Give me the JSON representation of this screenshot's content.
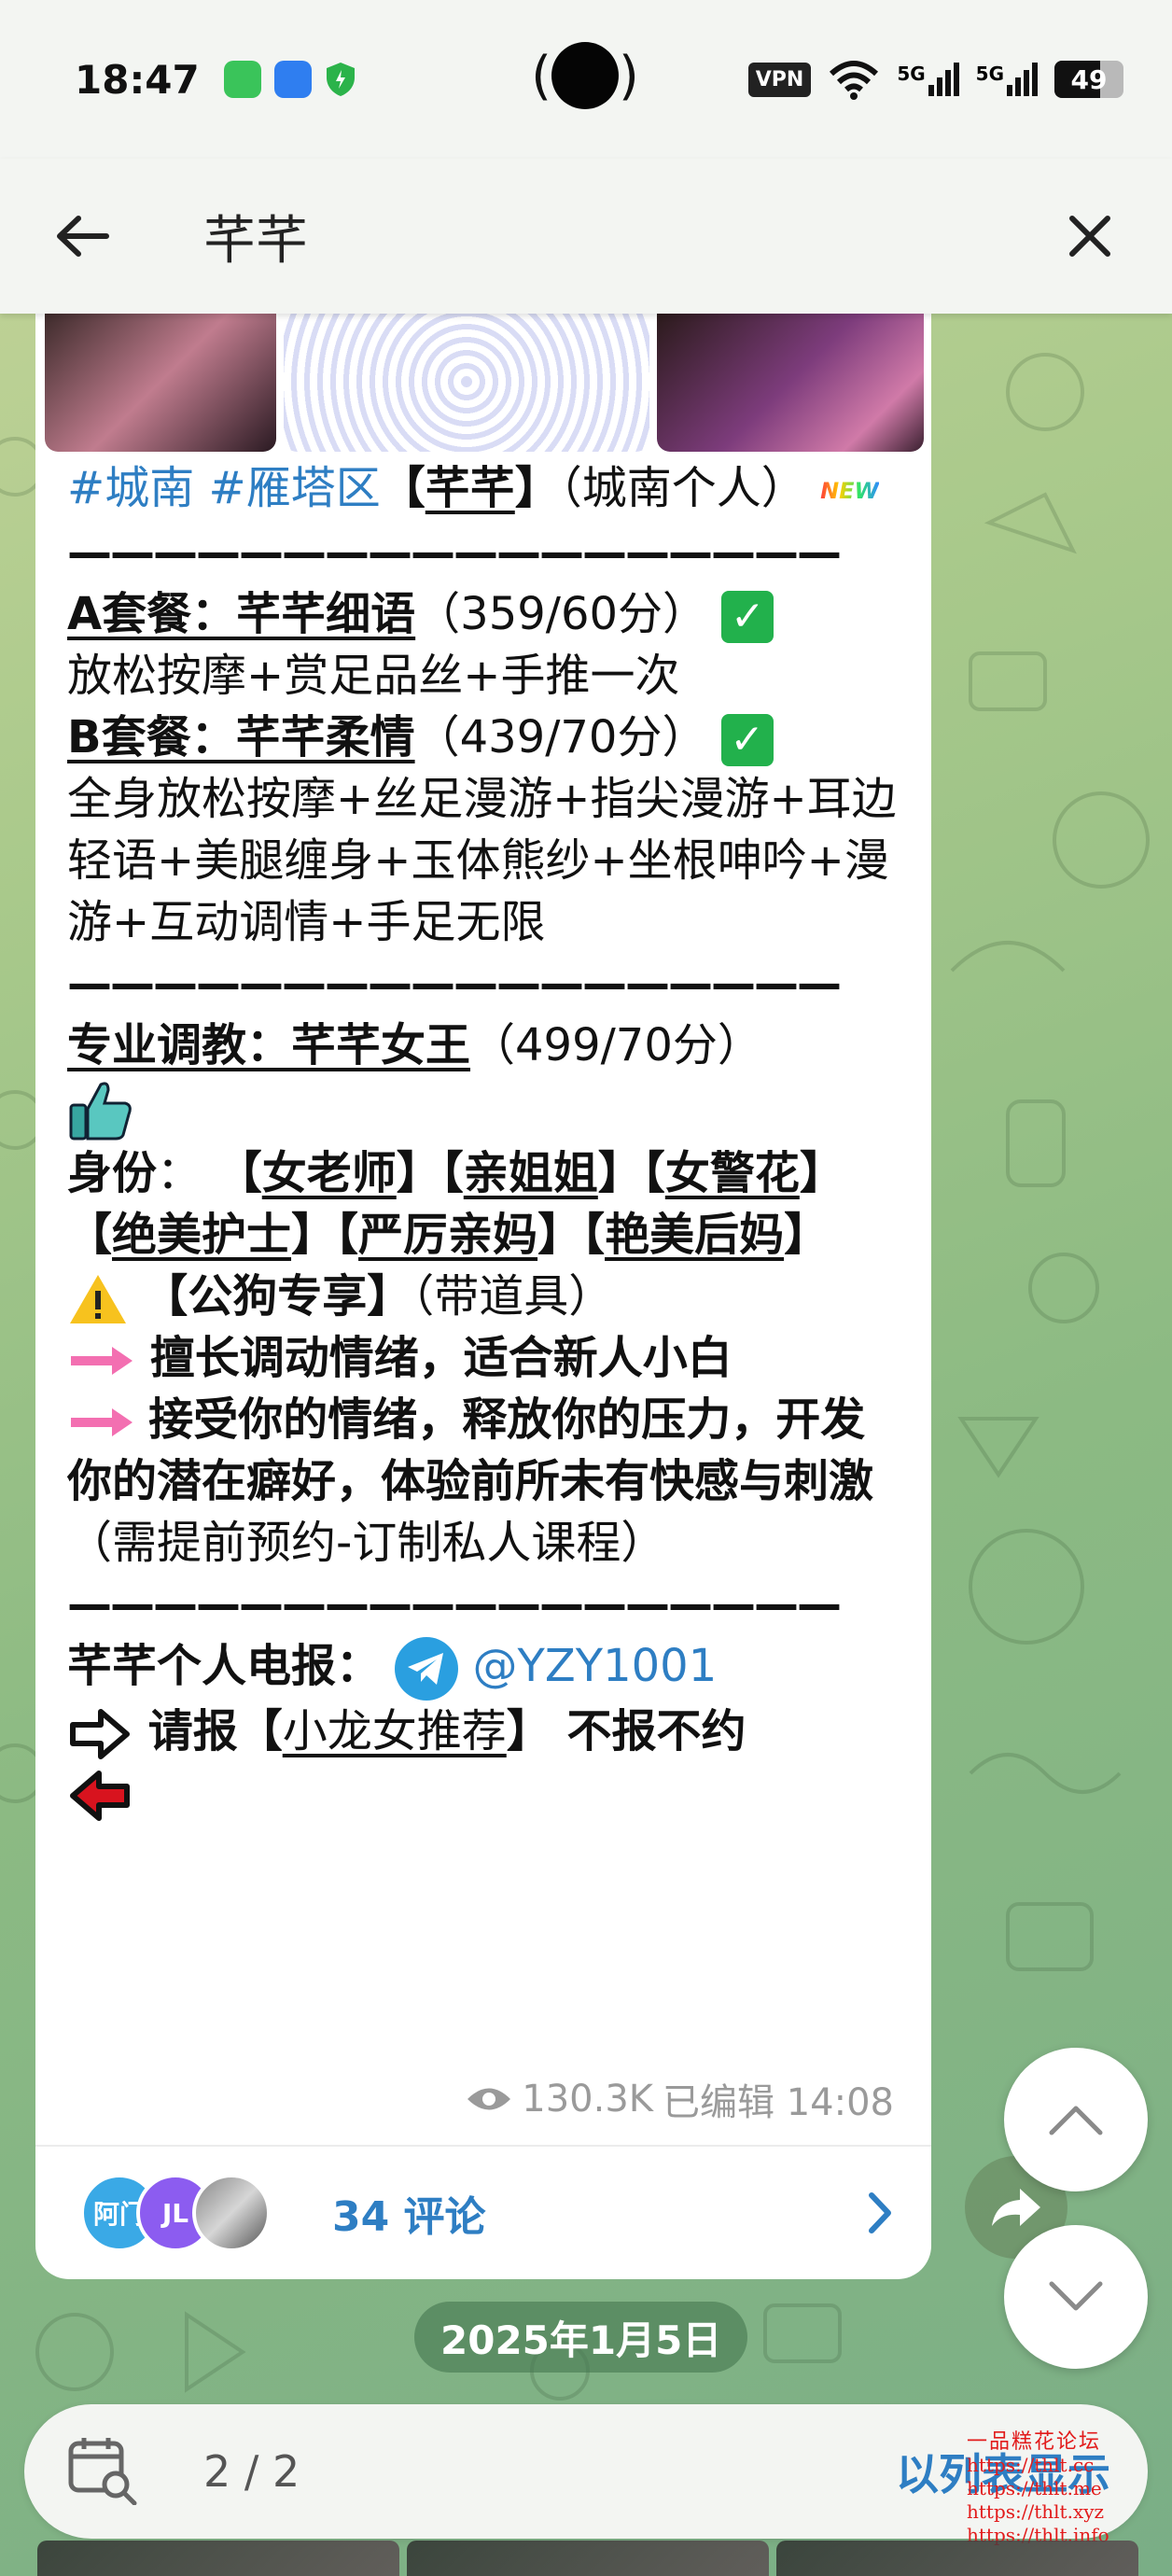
{
  "status_bar": {
    "time": "18:47",
    "vpn_label": "VPN",
    "signal_1": "5G",
    "signal_2": "5G",
    "battery": "49"
  },
  "header": {
    "search_query": "芊芊"
  },
  "post": {
    "tag1": "#城南",
    "tag2": "#雁塔区",
    "title_open": "【",
    "title_name": "芊芊",
    "title_close": "】",
    "title_suffix": "（城南个人）",
    "new_badge": "NEW",
    "divider": "——————————————————",
    "pkg_a_name": "A套餐：芊芊细语",
    "pkg_a_price": "（359/60分）",
    "pkg_a_desc": "放松按摩+赏足品丝+手推一次",
    "pkg_b_name": "B套餐：芊芊柔情",
    "pkg_b_price": "（439/70分）",
    "pkg_b_desc": "全身放松按摩+丝足漫游+指尖漫游+耳边轻语+美腿缠身+玉体熊纱+坐根呻吟+漫游+互动调情+手足无限",
    "pro_name": "专业调教：芊芊女王",
    "pro_price": "（499/70分）",
    "identity_label": "身份",
    "identity_colon": "：",
    "role1": "女老师",
    "role2": "亲姐姐",
    "role3": "女警花",
    "role4": "绝美护士",
    "role5": "严厉亲妈",
    "role6": "艳美后妈",
    "exclusive": "【公狗专享】",
    "exclusive_note": "（带道具）",
    "line1": "擅长调动情绪，适合新人小白",
    "line2": "接受你的情绪，释放你的压力，开发你的潜在癖好，体验前所未有快感与刺激",
    "line2_note": "（需提前预约-订制私人课程）",
    "telegram_label": "芊芊个人电报：",
    "telegram_handle": "@YZY1001",
    "report_prefix": "请报【",
    "report_name": "小龙女推荐",
    "report_suffix": "】 不报不约"
  },
  "meta": {
    "views": "130.3K",
    "edited": "已编辑 14:08"
  },
  "comments": {
    "avatar1": "阿门",
    "avatar2": "JL",
    "label": "34 评论"
  },
  "date_pill": "2025年1月5日",
  "bottom_bar": {
    "counter": "2 / 2",
    "list_mode": "以列表显示"
  },
  "watermark": {
    "title": "一品糕花论坛",
    "lines": [
      "https://thlt.cc",
      "https://thlt.me",
      "https://thlt.xyz",
      "https://thlt.info"
    ]
  },
  "colors": {
    "link": "#2e7ec3",
    "chat_bg": "#a9c98b",
    "bubble": "#ffffff"
  }
}
